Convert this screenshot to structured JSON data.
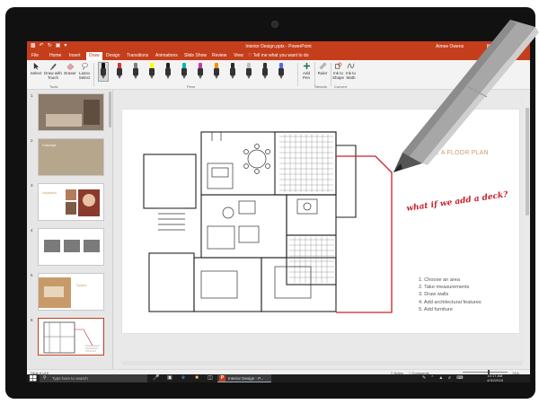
{
  "app": {
    "window_title": "Interior Design.pptx - PowerPoint",
    "user": "Aimee Owens"
  },
  "qat": {
    "save_icon": "save-icon",
    "undo_icon": "undo-icon",
    "redo_icon": "redo-icon",
    "start_icon": "present-from-start-icon",
    "customize_icon": "customize-qat-icon"
  },
  "window_controls": {
    "ribbon_display": "ribbon-display-icon",
    "minimize": "—",
    "maximize": "□",
    "close": "✕"
  },
  "tabs": [
    {
      "label": "File"
    },
    {
      "label": "Home"
    },
    {
      "label": "Insert"
    },
    {
      "label": "Draw"
    },
    {
      "label": "Design"
    },
    {
      "label": "Transitions"
    },
    {
      "label": "Animations"
    },
    {
      "label": "Slide Show"
    },
    {
      "label": "Review"
    },
    {
      "label": "View"
    }
  ],
  "active_tab": "Draw",
  "tell_me": "♡ Tell me what you want to do",
  "share": "Share",
  "ribbon": {
    "tools": [
      {
        "label": "Select",
        "icon": "select-cursor-icon"
      },
      {
        "label": "Draw with Touch",
        "icon": "draw-with-touch-icon"
      },
      {
        "label": "Eraser",
        "icon": "eraser-icon"
      },
      {
        "label": "Lasso Select",
        "icon": "lasso-select-icon"
      }
    ],
    "tools_group": "Tools",
    "pens": [
      {
        "color": "#111111"
      },
      {
        "color": "#d13438"
      },
      {
        "color": "#7f7f7f"
      },
      {
        "color": "#ffff00"
      },
      {
        "color": "#222222"
      },
      {
        "color": "#00b7c3"
      },
      {
        "color": "#c239b3"
      },
      {
        "color": "#ff8c00"
      },
      {
        "color": "#2d2d2d"
      },
      {
        "color": "#bfbfbf"
      },
      {
        "color": "#333333"
      },
      {
        "color": "#4f6bed"
      }
    ],
    "pens_group": "Pens",
    "add_pen": {
      "label": "Add Pen",
      "icon": "add-pen-icon"
    },
    "ruler": {
      "label": "Ruler",
      "icon": "ruler-icon"
    },
    "stencils_group": "Stencils",
    "ink_to_shape": {
      "label": "Ink to Shape",
      "icon": "ink-to-shape-icon"
    },
    "ink_to_math": {
      "label": "Ink to Math",
      "icon": "ink-to-math-icon"
    },
    "convert_group": "Convert"
  },
  "thumbnails": [
    {
      "num": "1",
      "bg": "#8a7868",
      "text": ""
    },
    {
      "num": "2",
      "bg": "#b5a68c",
      "text": "Concept"
    },
    {
      "num": "3",
      "bg": "#ffffff",
      "text": "Inspiration"
    },
    {
      "num": "4",
      "bg": "#ffffff",
      "text": ""
    },
    {
      "num": "5",
      "bg": "#ffffff",
      "text": "Space"
    },
    {
      "num": "6",
      "bg": "#ffffff",
      "text": ""
    }
  ],
  "slide": {
    "title": "CREATE A FLOOR PLAN",
    "handwriting": "what if we add a deck?",
    "steps": [
      "1. Choose an area",
      "2. Take measurements",
      "3. Draw walls",
      "4. Add architectural features",
      "5. Add furniture"
    ],
    "ink_color": "#c8202a"
  },
  "status": {
    "slide_info": "Slide 6 of 6",
    "notes": "≡ Notes",
    "comments": "□ Comments",
    "zoom": "74%"
  },
  "taskbar": {
    "search_placeholder": "Type here to search",
    "search_icon": "search-icon",
    "start_icon": "windows-start-icon",
    "apps": [
      "microphone-icon",
      "task-view-icon",
      "edge-icon",
      "file-explorer-icon",
      "store-icon"
    ],
    "active_app": "Interior Design - P...",
    "tray_icons": [
      "pen-workspace-icon",
      "chevron-up-icon",
      "network-icon",
      "volume-icon",
      "keyboard-icon"
    ],
    "time": "10:17 AM",
    "date": "4/30/2018"
  },
  "colors": {
    "accent": "#c43e1c",
    "taskbar": "#1d1d1d"
  }
}
